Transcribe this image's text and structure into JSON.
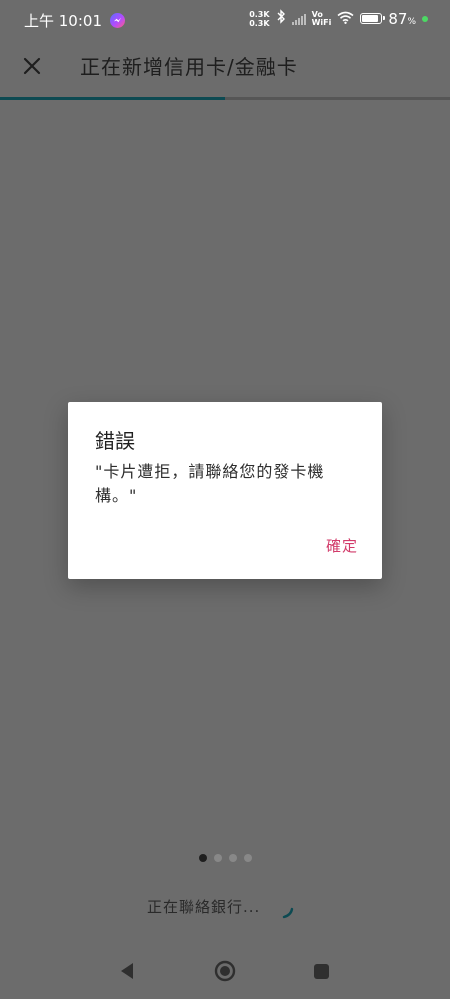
{
  "status_bar": {
    "time": "上午 10:01",
    "net_speed_up": "0.3K",
    "net_speed_down": "0.3K",
    "vowifi_top": "Vo",
    "vowifi_bottom": "WiFi",
    "battery_percent": "87",
    "battery_unit": "%",
    "battery_level": 0.87,
    "icons": [
      "messenger-icon",
      "bluetooth-icon",
      "signal-icon",
      "wifi-icon",
      "battery-icon"
    ]
  },
  "app_bar": {
    "title": "正在新增信用卡/金融卡",
    "close_icon": "close-icon"
  },
  "progress": {
    "value": 0.5
  },
  "dialog": {
    "title": "錯誤",
    "message": "\"卡片遭拒，請聯絡您的發卡機構。\"",
    "confirm_label": "確定",
    "accent_color": "#d23b6a"
  },
  "pager": {
    "count": 4,
    "active_index": 0
  },
  "loading": {
    "text": "正在聯絡銀行..."
  },
  "nav_bar": {
    "icons": [
      "back-icon",
      "home-icon",
      "recents-icon"
    ]
  },
  "colors": {
    "scrim_background": "#6c6c6c",
    "progress_fill": "#0d4a52",
    "spinner": "#0d4a52"
  }
}
